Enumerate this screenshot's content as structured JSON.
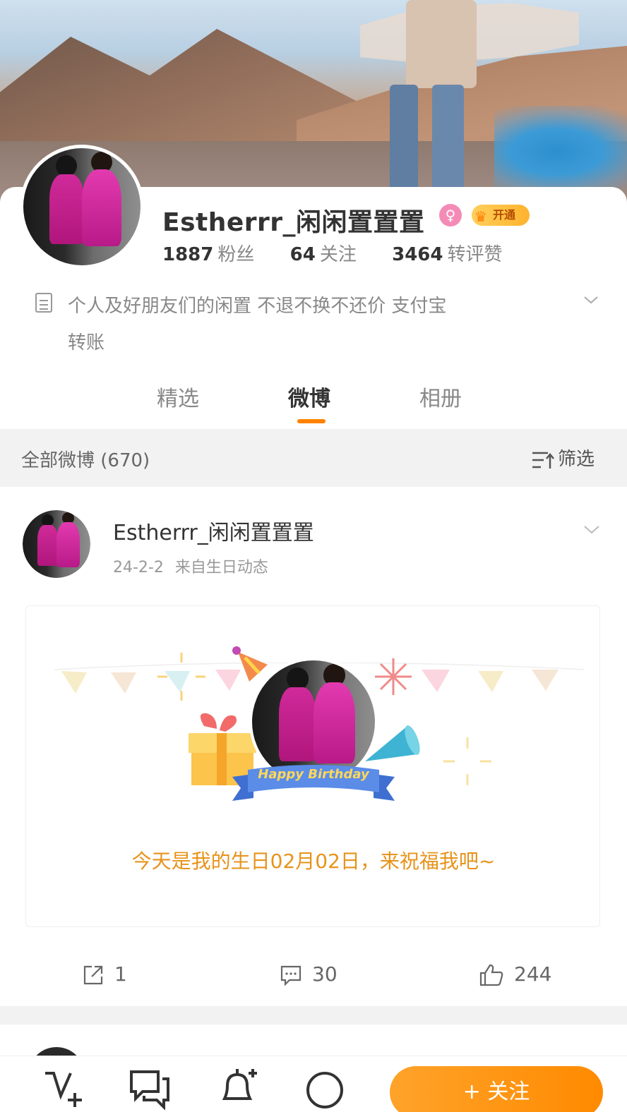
{
  "profile": {
    "name": "Estherrr_闲闲置置置",
    "vip_label": "开通",
    "stats": [
      {
        "num": "1887",
        "label": "粉丝"
      },
      {
        "num": "64",
        "label": "关注"
      },
      {
        "num": "3464",
        "label": "转评赞"
      }
    ],
    "bio_line1": "个人及好朋友们的闲置 不退不换不还价 支付宝",
    "bio_line2": "转账"
  },
  "tabs": [
    "精选",
    "微博",
    "相册"
  ],
  "filter": {
    "count_label": "全部微博 (670)",
    "button_label": "筛选"
  },
  "post": {
    "author": "Estherrr_闲闲置置置",
    "date": "24-2-2",
    "source": "来自生日动态",
    "ribbon_text": "Happy Birthday",
    "card_text": "今天是我的生日02月02日，来祝福我吧~",
    "reposts": "1",
    "comments": "30",
    "likes": "244"
  },
  "bottom": {
    "follow_label": "+ 关注"
  },
  "colors": {
    "accent": "#ff8200",
    "birthday_text": "#e7931b",
    "gender_badge": "#f48bb6"
  }
}
